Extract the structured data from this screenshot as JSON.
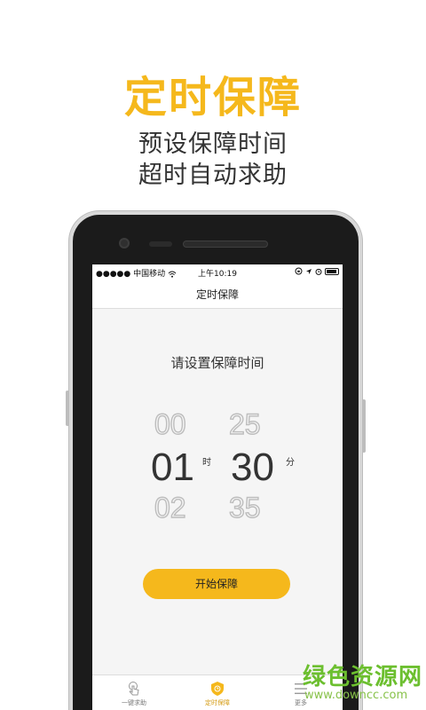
{
  "promo": {
    "title": "定时保障",
    "subtitle_line1": "预设保障时间",
    "subtitle_line2": "超时自动求助"
  },
  "status_bar": {
    "signal": "●●●●● ",
    "carrier": "中国移动",
    "time": "上午10:19"
  },
  "nav": {
    "title": "定时保障"
  },
  "timer": {
    "prompt": "请设置保障时间",
    "hours": {
      "prev": "00",
      "selected": "01",
      "next": "02",
      "unit": "时"
    },
    "minutes": {
      "prev": "25",
      "selected": "30",
      "next": "35",
      "unit": "分"
    }
  },
  "start_button": {
    "label": "开始保障"
  },
  "tabs": [
    {
      "label": "一键求助",
      "icon": "hand-tap-icon",
      "active": false
    },
    {
      "label": "定时保障",
      "icon": "shield-clock-icon",
      "active": true
    },
    {
      "label": "更多",
      "icon": "menu-icon",
      "active": false
    }
  ],
  "watermark": {
    "text": "绿色资源网",
    "url": "www.downcc.com"
  },
  "colors": {
    "accent": "#f5b81c",
    "watermark_green": "#6cbf2f"
  }
}
